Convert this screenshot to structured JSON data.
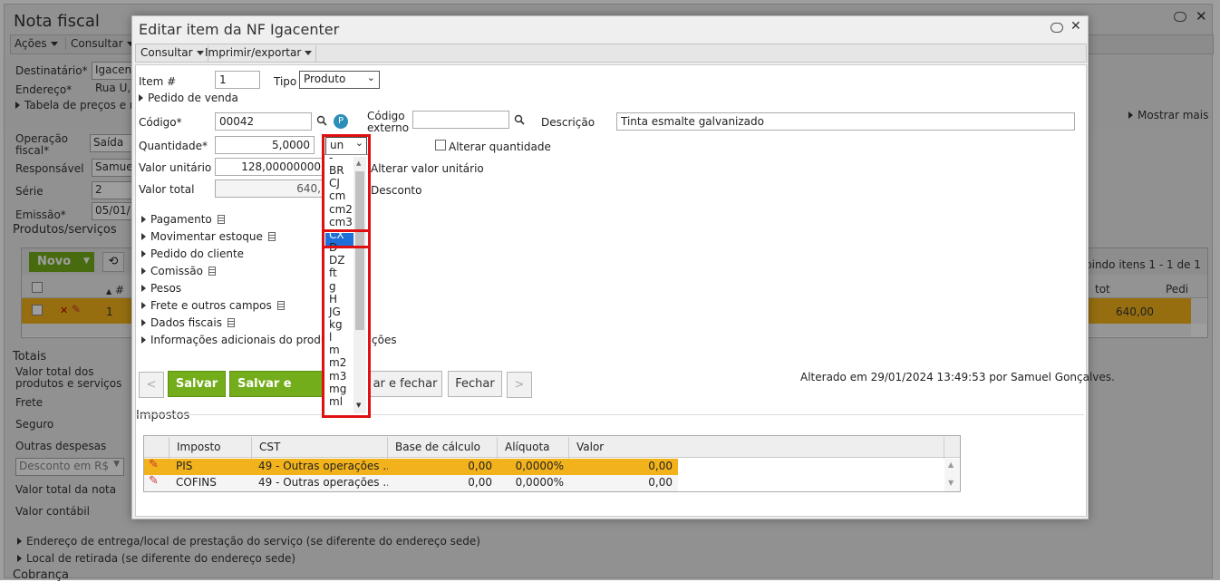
{
  "background": {
    "title": "Nota fiscal",
    "toolbar": {
      "acoes": "Ações",
      "consultar": "Consultar"
    },
    "fields": {
      "destinatario_label": "Destinatário*",
      "destinatario_value": "Igacent",
      "endereco_label": "Endereço*",
      "endereco_value": "Rua U,",
      "tabela_precos": "Tabela de preços e re",
      "mostrar_mais": "Mostrar mais",
      "operacao_label_1": "Operação",
      "operacao_label_2": "fiscal*",
      "operacao_value": "Saída",
      "responsavel_label": "Responsável",
      "responsavel_value": "Samue",
      "serie_label": "Série",
      "serie_value": "2",
      "emissao_label": "Emissão*",
      "emissao_value": "05/01/",
      "produtos_servicos": "Produtos/serviços"
    },
    "grid": {
      "novo": "Novo",
      "exibindo": "bindo itens 1 - 1 de 1",
      "col_num": "#",
      "col_tot": "tot",
      "col_pedi": "Pedi",
      "row_num": "1",
      "row_total": "640,00"
    },
    "totais": {
      "title": "Totais",
      "valor_total_1": "Valor total dos",
      "valor_total_2": "produtos e serviços",
      "frete": "Frete",
      "seguro": "Seguro",
      "outras_despesas": "Outras despesas",
      "desconto_select": "Desconto em R$",
      "valor_total_nota": "Valor total da nota",
      "valor_contabil": "Valor contábil"
    },
    "endereco_entrega": "Endereço de entrega/local de prestação do serviço (se diferente do endereço sede)",
    "local_retirada": "Local de retirada (se diferente do endereço sede)",
    "cobranca": "Cobrança"
  },
  "dialog": {
    "title": "Editar item da NF Igacenter",
    "toolbar": {
      "consultar": "Consultar",
      "imprimir": "Imprimir/exportar"
    },
    "item_label": "Item #",
    "item_value": "1",
    "tipo_label": "Tipo",
    "tipo_value": "Produto",
    "pedido_venda": "Pedido de venda",
    "codigo_label": "Código*",
    "codigo_value": "00042",
    "codigo_externo_1": "Código",
    "codigo_externo_2": "externo",
    "codigo_externo_value": "",
    "descricao_label": "Descrição",
    "descricao_value": "Tinta esmalte galvanizado",
    "quantidade_label": "Quantidade*",
    "quantidade_value": "5,0000",
    "unidade_value": "un",
    "alterar_quantidade": "Alterar quantidade",
    "valor_unitario_label": "Valor unitário",
    "valor_unitario_value": "128,00000000",
    "alterar_valor_unitario": "Alterar valor unitário",
    "valor_total_label": "Valor total",
    "valor_total_value": "640,",
    "desconto": "Desconto",
    "sections": [
      "Pagamento",
      "Movimentar estoque",
      "Pedido do cliente",
      "Comissão",
      "Pesos",
      "Frete e outros campos",
      "Dados fiscais",
      "Informações adicionais do produto e observações"
    ],
    "info_part1": "Informações adicionais do produto e",
    "info_part2": "ções",
    "buttons": {
      "prev": "<",
      "salvar": "Salvar",
      "salvar_novo": "Salvar e novo",
      "salvar_fechar": "ar e fechar",
      "fechar": "Fechar",
      "next": ">"
    },
    "alterado": "Alterado em 29/01/2024 13:49:53 por Samuel Gonçalves.",
    "impostos_title": "Impostos",
    "impostos_headers": [
      "Imposto",
      "CST",
      "Base de cálculo",
      "Alíquota",
      "Valor"
    ],
    "impostos_rows": [
      {
        "imposto": "PIS",
        "cst": "49 - Outras operações ...",
        "base": "0,00",
        "aliquota": "0,0000%",
        "valor": "0,00"
      },
      {
        "imposto": "COFINS",
        "cst": "49 - Outras operações ...",
        "base": "0,00",
        "aliquota": "0,0000%",
        "valor": "0,00"
      }
    ]
  },
  "unit_dropdown": {
    "options": [
      "-",
      "BR",
      "CJ",
      "cm",
      "cm2",
      "cm3",
      "CX",
      "D",
      "DZ",
      "ft",
      "g",
      "H",
      "JG",
      "kg",
      "l",
      "m",
      "m2",
      "m3",
      "mg",
      "ml"
    ],
    "highlighted": "CX"
  },
  "colors": {
    "accent_green": "#74ad1b",
    "row_selected": "#f2b21b",
    "highlight_blue": "#1e6fd9",
    "annotation_red": "#e01010"
  }
}
